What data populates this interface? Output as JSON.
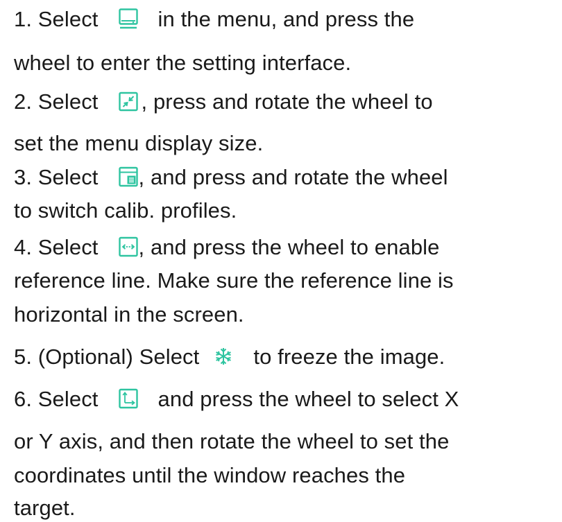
{
  "steps": [
    {
      "prefix": "1. Select",
      "icon": "display-monitor-icon",
      "line1_rest": "in the menu, and press the",
      "line2": "wheel to enter the setting interface."
    },
    {
      "prefix": "2. Select",
      "icon": "resize-arrows-icon",
      "line1_rest": ", press and rotate the wheel to",
      "line2": "set the menu display size."
    },
    {
      "prefix": "3. Select",
      "icon": "calibration-profile-icon",
      "line1_rest": ", and press and rotate the wheel",
      "line2": "to switch calib. profiles."
    },
    {
      "prefix": "4. Select",
      "icon": "reference-line-icon",
      "line1_rest": ", and press the wheel to enable",
      "line2": "reference line. Make sure the reference line is",
      "line3": "horizontal in the screen."
    },
    {
      "prefix": "5. (Optional) Select",
      "icon": "snowflake-freeze-icon",
      "line1_rest": "to freeze the image."
    },
    {
      "prefix": "6. Select",
      "icon": "xy-axis-coordinate-icon",
      "line1_rest": "and press the wheel to select X",
      "line2": "or Y axis, and then rotate the wheel to set the",
      "line3": "coordinates until the window reaches the",
      "line4": "target."
    }
  ],
  "icon_color": "#2ec4a0"
}
